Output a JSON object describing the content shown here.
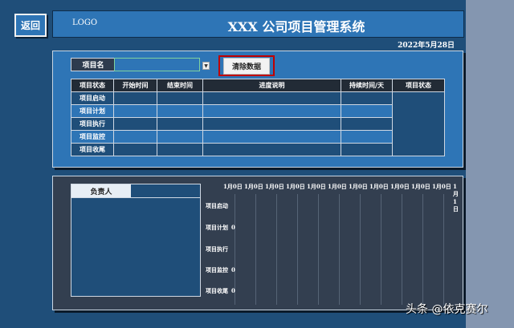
{
  "nav": {
    "back_label": "返回"
  },
  "header": {
    "logo": "LOGO",
    "title": "XXX 公司项目管理系统",
    "date": "2022年5月28日"
  },
  "project": {
    "name_label": "项目名",
    "name_value": "",
    "clear_label": "清除数据"
  },
  "table": {
    "columns": [
      "项目状态",
      "开始时间",
      "结束时间",
      "进度说明",
      "持续时间/天",
      "项目状态"
    ],
    "rows": [
      "项目启动",
      "项目计划",
      "项目执行",
      "项目监控",
      "项目收尾"
    ]
  },
  "owner": {
    "label": "负责人"
  },
  "gantt": {
    "dates": [
      "1月0日",
      "1月0日",
      "1月0日",
      "1月0日",
      "1月0日",
      "1月0日",
      "1月0日",
      "1月0日",
      "1月0日",
      "1月0日",
      "1月0日",
      "1月1日"
    ],
    "rows": [
      {
        "label": "项目启动",
        "value": ""
      },
      {
        "label": "项目计划",
        "value": "0"
      },
      {
        "label": "项目执行",
        "value": ""
      },
      {
        "label": "项目监控",
        "value": "0"
      },
      {
        "label": "项目收尾",
        "value": "0"
      }
    ]
  },
  "watermark": "头条 @依克赛尔",
  "colors": {
    "background": "#1f4e79",
    "panel": "#2e75b6",
    "panel_dark": "#333f50",
    "highlight_border": "#c00000"
  }
}
